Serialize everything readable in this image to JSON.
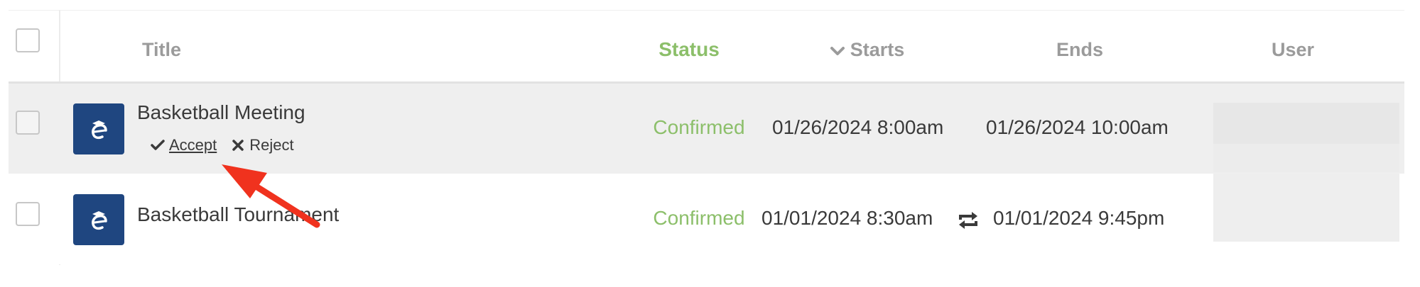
{
  "columns": {
    "title": "Title",
    "status": "Status",
    "starts": "Starts",
    "ends": "Ends",
    "user": "User"
  },
  "rows": [
    {
      "title": "Basketball Meeting",
      "status": "Confirmed",
      "starts": "01/26/2024 8:00am",
      "ends": "01/26/2024 10:00am",
      "actions": {
        "accept": "Accept",
        "reject": "Reject"
      }
    },
    {
      "title": "Basketball Tournament",
      "status": "Confirmed",
      "starts": "01/01/2024 8:30am",
      "ends": "01/01/2024 9:45pm"
    }
  ],
  "colors": {
    "confirmed": "#8cbf6a",
    "logo_bg": "#1f4680",
    "annotation_arrow": "#f0321e"
  }
}
